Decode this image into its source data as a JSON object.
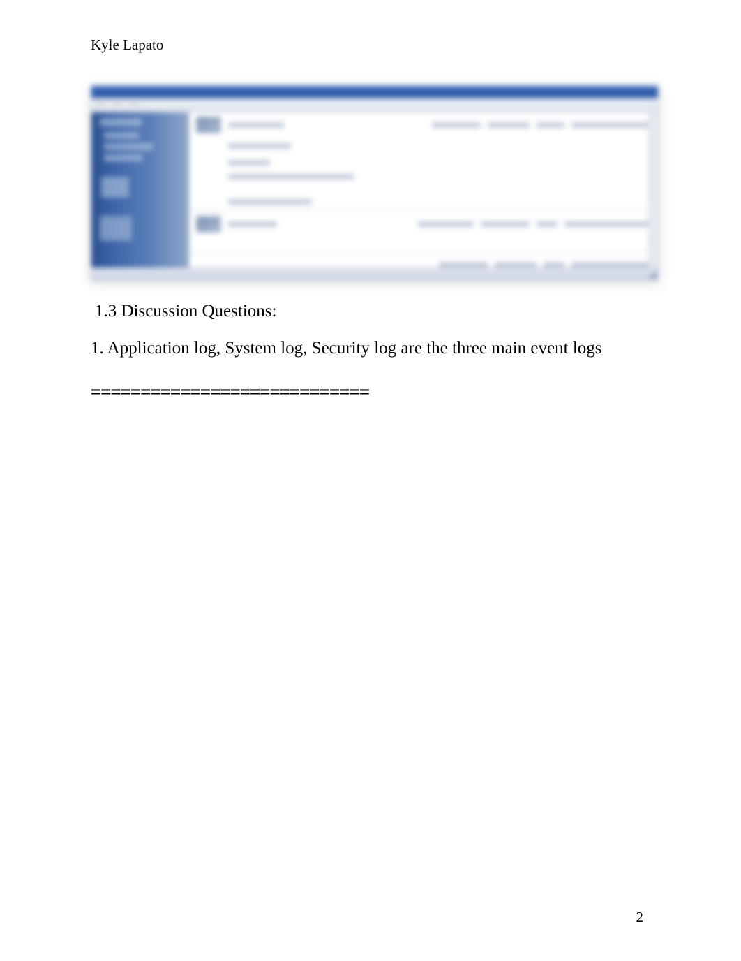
{
  "author": "Kyle Lapato",
  "sectionHeading": " 1.3 Discussion Questions:",
  "answer": "1. Application log, System log, Security log are the three main event logs",
  "separator": "============================",
  "pageNumber": "2"
}
